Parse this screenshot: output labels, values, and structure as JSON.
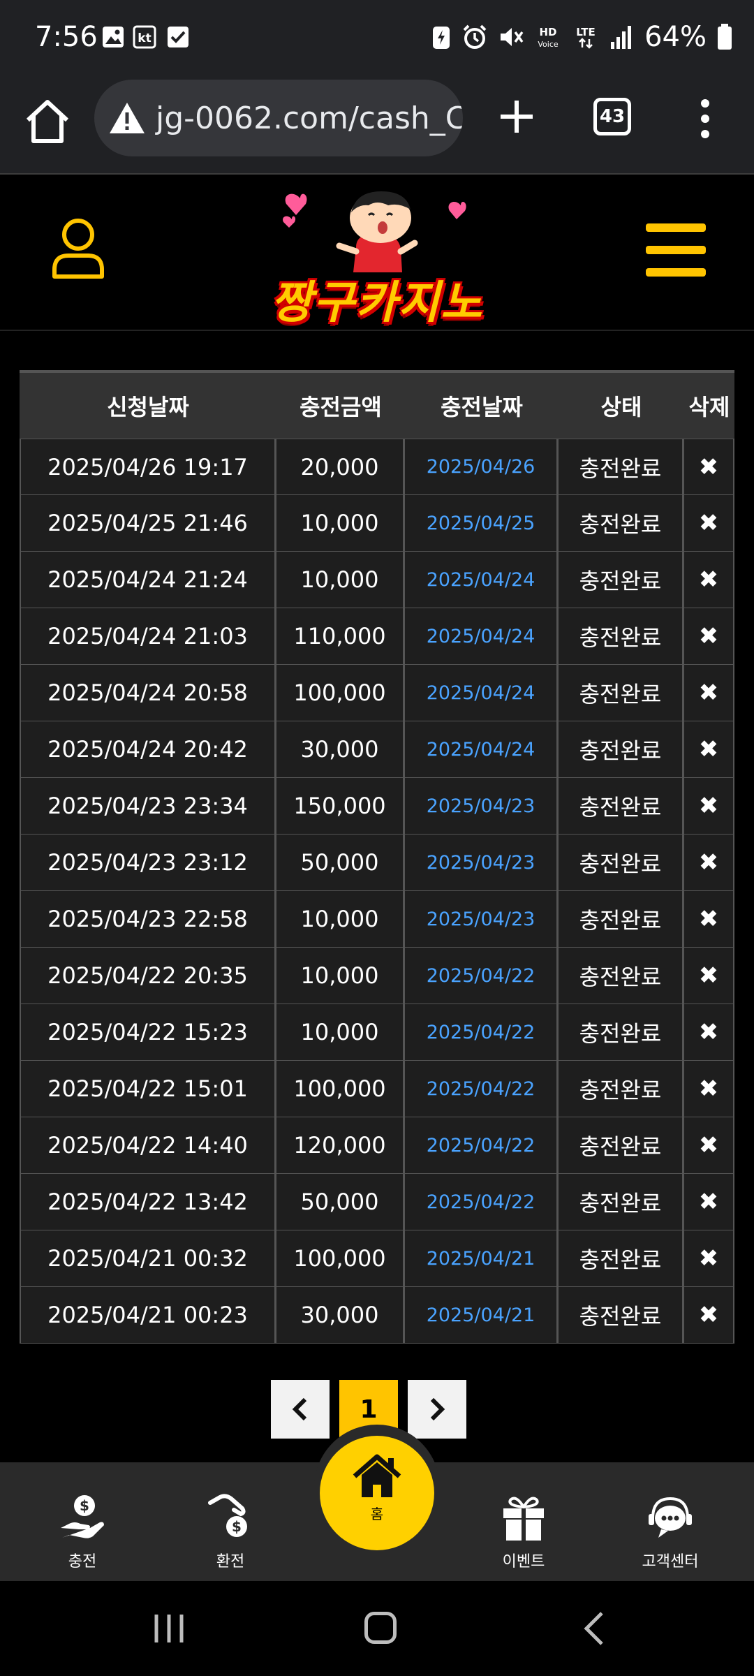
{
  "status_bar": {
    "time": "7:56",
    "battery": "64%"
  },
  "browser": {
    "url": "jg-0062.com/cash_C",
    "tab_count": "43"
  },
  "site": {
    "logo_text": "짱구카지노"
  },
  "table": {
    "headers": [
      "신청날짜",
      "충전금액",
      "충전날짜",
      "상태",
      "삭제"
    ],
    "rows": [
      {
        "request_date": "2025/04/26 19:17",
        "amount": "20,000",
        "charge_date": "2025/04/26",
        "status": "충전완료",
        "delete": "✖"
      },
      {
        "request_date": "2025/04/25 21:46",
        "amount": "10,000",
        "charge_date": "2025/04/25",
        "status": "충전완료",
        "delete": "✖"
      },
      {
        "request_date": "2025/04/24 21:24",
        "amount": "10,000",
        "charge_date": "2025/04/24",
        "status": "충전완료",
        "delete": "✖"
      },
      {
        "request_date": "2025/04/24 21:03",
        "amount": "110,000",
        "charge_date": "2025/04/24",
        "status": "충전완료",
        "delete": "✖"
      },
      {
        "request_date": "2025/04/24 20:58",
        "amount": "100,000",
        "charge_date": "2025/04/24",
        "status": "충전완료",
        "delete": "✖"
      },
      {
        "request_date": "2025/04/24 20:42",
        "amount": "30,000",
        "charge_date": "2025/04/24",
        "status": "충전완료",
        "delete": "✖"
      },
      {
        "request_date": "2025/04/23 23:34",
        "amount": "150,000",
        "charge_date": "2025/04/23",
        "status": "충전완료",
        "delete": "✖"
      },
      {
        "request_date": "2025/04/23 23:12",
        "amount": "50,000",
        "charge_date": "2025/04/23",
        "status": "충전완료",
        "delete": "✖"
      },
      {
        "request_date": "2025/04/23 22:58",
        "amount": "10,000",
        "charge_date": "2025/04/23",
        "status": "충전완료",
        "delete": "✖"
      },
      {
        "request_date": "2025/04/22 20:35",
        "amount": "10,000",
        "charge_date": "2025/04/22",
        "status": "충전완료",
        "delete": "✖"
      },
      {
        "request_date": "2025/04/22 15:23",
        "amount": "10,000",
        "charge_date": "2025/04/22",
        "status": "충전완료",
        "delete": "✖"
      },
      {
        "request_date": "2025/04/22 15:01",
        "amount": "100,000",
        "charge_date": "2025/04/22",
        "status": "충전완료",
        "delete": "✖"
      },
      {
        "request_date": "2025/04/22 14:40",
        "amount": "120,000",
        "charge_date": "2025/04/22",
        "status": "충전완료",
        "delete": "✖"
      },
      {
        "request_date": "2025/04/22 13:42",
        "amount": "50,000",
        "charge_date": "2025/04/22",
        "status": "충전완료",
        "delete": "✖"
      },
      {
        "request_date": "2025/04/21 00:32",
        "amount": "100,000",
        "charge_date": "2025/04/21",
        "status": "충전완료",
        "delete": "✖"
      },
      {
        "request_date": "2025/04/21 00:23",
        "amount": "30,000",
        "charge_date": "2025/04/21",
        "status": "충전완료",
        "delete": "✖"
      }
    ]
  },
  "pagination": {
    "current": "1"
  },
  "bottom_nav": {
    "charge": "충전",
    "exchange": "환전",
    "home": "홈",
    "event": "이벤트",
    "support": "고객센터"
  },
  "colors": {
    "accent": "#ffc400",
    "date_link": "#4aa3ff"
  }
}
